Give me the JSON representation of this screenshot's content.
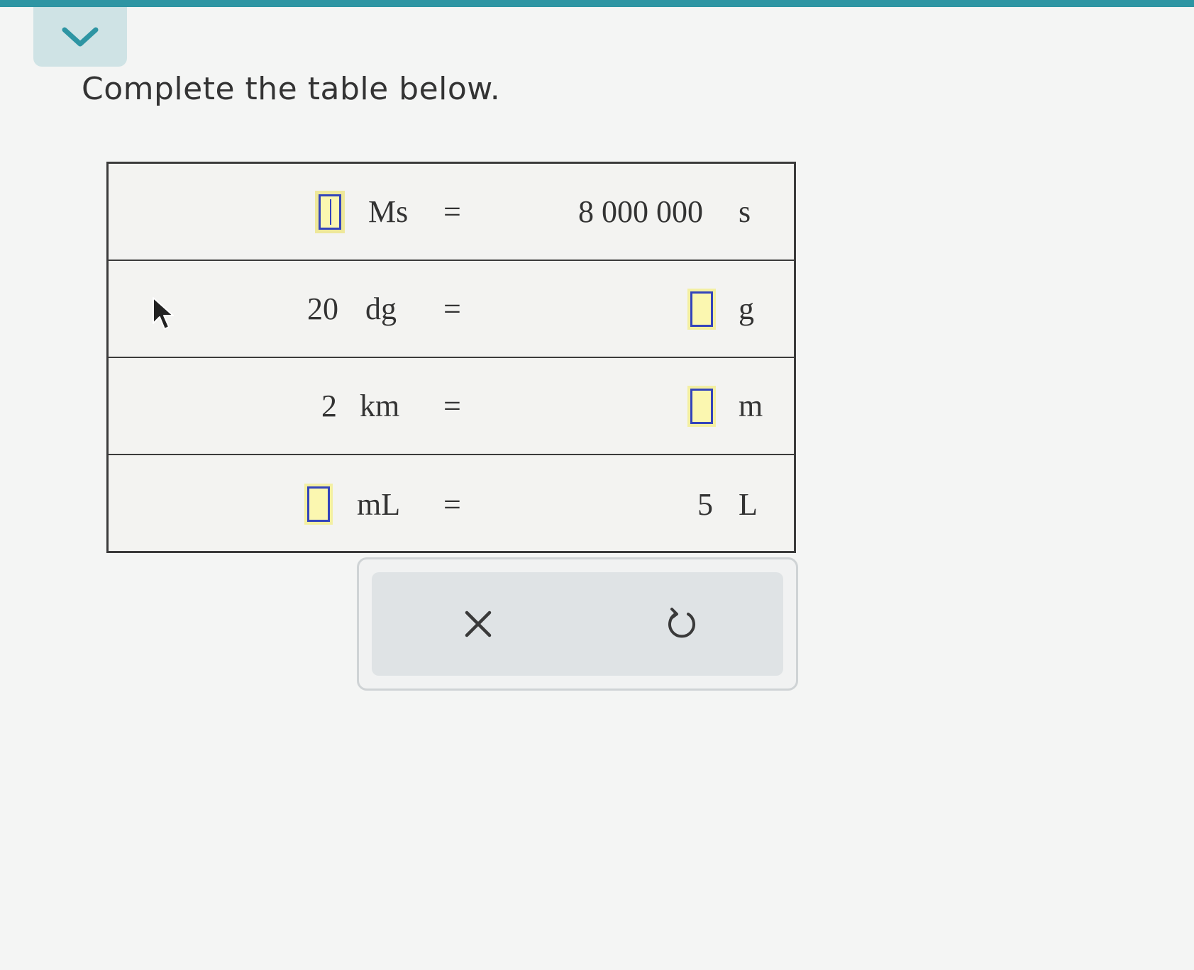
{
  "header": {
    "collapse_icon": "chevron-down-icon",
    "accent_color": "#2e95a3"
  },
  "instruction": "Complete the table below.",
  "table": {
    "rows": [
      {
        "left_value": "",
        "left_unit": "Ms",
        "equals": "=",
        "right_value": "8 000 000",
        "right_unit": "s",
        "blank_side": "left"
      },
      {
        "left_value": "20",
        "left_unit": "dg",
        "equals": "=",
        "right_value": "",
        "right_unit": "g",
        "blank_side": "right"
      },
      {
        "left_value": "2",
        "left_unit": "km",
        "equals": "=",
        "right_value": "",
        "right_unit": "m",
        "blank_side": "right"
      },
      {
        "left_value": "",
        "left_unit": "mL",
        "equals": "=",
        "right_value": "5",
        "right_unit": "L",
        "blank_side": "left"
      }
    ]
  },
  "actions": {
    "clear_icon": "close-icon",
    "undo_icon": "undo-icon"
  }
}
